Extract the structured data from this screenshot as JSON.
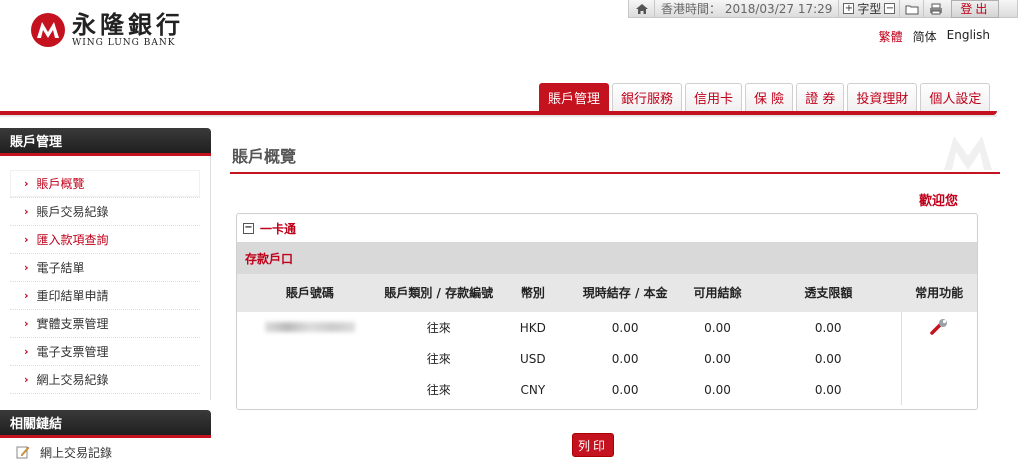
{
  "utilbar": {
    "time_label": "香港時間：",
    "time_value": "2018/03/27 17:29",
    "font_plus": "+",
    "font_label": "字型",
    "font_minus": "−",
    "logout_label": "登出",
    "icons": [
      "home-icon",
      "folder-icon",
      "print-icon"
    ]
  },
  "logo": {
    "cn": "永隆銀行",
    "en": "WING LUNG BANK"
  },
  "langs": [
    "繁體",
    "简体",
    "English"
  ],
  "nav": {
    "tabs": [
      {
        "label": "賬戶管理",
        "active": true
      },
      {
        "label": "銀行服務"
      },
      {
        "label": "信用卡"
      },
      {
        "label": "保 險"
      },
      {
        "label": "證 券"
      },
      {
        "label": "投資理財"
      },
      {
        "label": "個人設定"
      }
    ]
  },
  "sidebar": {
    "heading": "賬戶管理",
    "items": [
      {
        "label": "賬戶概覽",
        "state": "active"
      },
      {
        "label": "賬戶交易紀錄"
      },
      {
        "label": "匯入款項查詢",
        "state": "red"
      },
      {
        "label": "電子結單"
      },
      {
        "label": "重印結單申請"
      },
      {
        "label": "實體支票管理"
      },
      {
        "label": "電子支票管理"
      },
      {
        "label": "網上交易紀錄"
      }
    ],
    "heading2": "相關鏈結",
    "links": [
      {
        "label": "網上交易記錄"
      }
    ]
  },
  "main": {
    "title": "賬戶概覽",
    "welcome": "歡迎您",
    "panel_title": "一卡通",
    "section_title": "存款戶口",
    "columns": [
      "賬戶號碼",
      "賬戶類別 / 存款編號",
      "幣別",
      "現時結存 / 本金",
      "可用結餘",
      "透支限額",
      "常用功能"
    ],
    "rows": [
      {
        "type": "往來",
        "currency": "HKD",
        "balance": "0.00",
        "available": "0.00",
        "overdraft": "0.00"
      },
      {
        "type": "往來",
        "currency": "USD",
        "balance": "0.00",
        "available": "0.00",
        "overdraft": "0.00"
      },
      {
        "type": "往來",
        "currency": "CNY",
        "balance": "0.00",
        "available": "0.00",
        "overdraft": "0.00"
      }
    ],
    "print_label": "列印"
  }
}
